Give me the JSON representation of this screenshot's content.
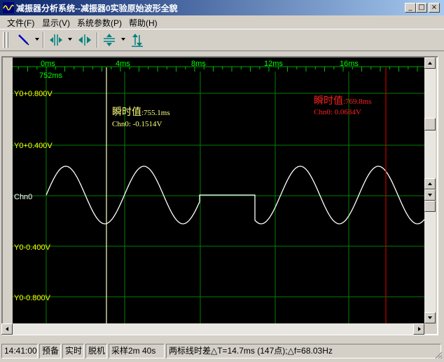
{
  "window": {
    "title": "减振器分析系统--减振器0实验原始波形全貌",
    "buttons": {
      "minimize": "_",
      "maximize": "□",
      "close": "×"
    }
  },
  "menu": [
    {
      "label": "文件(F)"
    },
    {
      "label": "显示(V)"
    },
    {
      "label": "系统参数(P)"
    },
    {
      "label": "帮助(H)"
    }
  ],
  "toolbar": {
    "icons": [
      "pen-icon",
      "horizontal-zoom-icon",
      "horizontal-move-icon",
      "vertical-zoom-icon",
      "vertical-swap-icon"
    ]
  },
  "plot": {
    "x_axis": {
      "labels": [
        "0ms",
        "4ms",
        "8ms",
        "12ms",
        "16ms"
      ],
      "offset_label": "752ms"
    },
    "y_axis": {
      "labels": [
        "Y0+0.800V",
        "Y0+0.400V",
        "Chn0",
        "Y0-0.400V",
        "Y0-0.800V"
      ]
    },
    "cursor1": {
      "title": "瞬时值",
      "time": ":755.1ms",
      "value": "Chn0: -0.1514V",
      "color": "#ffff80"
    },
    "cursor2": {
      "title": "瞬时值",
      "time": ":769.8ms",
      "value": "Chn0: 0.0684V",
      "color": "#ff2020"
    },
    "colors": {
      "background": "#000000",
      "grid": "#008000",
      "axis_labels": "#00ff00",
      "y_labels": "#ffff00",
      "waveform": "#ffffff",
      "cursor1_line": "#ffffc0",
      "cursor2_line": "#c00000"
    }
  },
  "status": {
    "time": "14:41:00",
    "state1": "预备",
    "state2": "实时",
    "state3": "脱机",
    "sampling": "采样2m 40s",
    "measurement": "两标线时差△T=14.7ms (147点);△f=68.03Hz"
  }
}
